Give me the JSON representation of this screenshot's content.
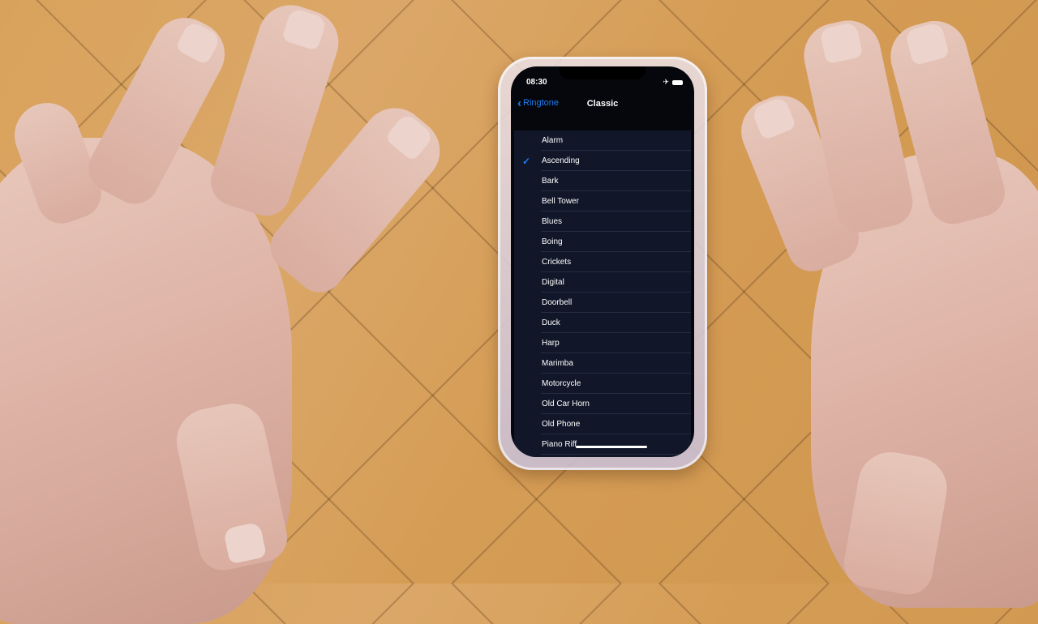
{
  "status_bar": {
    "time": "08:30",
    "icons": [
      "airplane-mode-icon",
      "battery-icon"
    ]
  },
  "nav": {
    "back_label": "Ringtone",
    "back_icon": "chevron-left-icon",
    "title": "Classic"
  },
  "ringtones": {
    "selected": "Ascending",
    "items": [
      {
        "label": "Alarm",
        "checked": false
      },
      {
        "label": "Ascending",
        "checked": true
      },
      {
        "label": "Bark",
        "checked": false
      },
      {
        "label": "Bell Tower",
        "checked": false
      },
      {
        "label": "Blues",
        "checked": false
      },
      {
        "label": "Boing",
        "checked": false
      },
      {
        "label": "Crickets",
        "checked": false
      },
      {
        "label": "Digital",
        "checked": false
      },
      {
        "label": "Doorbell",
        "checked": false
      },
      {
        "label": "Duck",
        "checked": false
      },
      {
        "label": "Harp",
        "checked": false
      },
      {
        "label": "Marimba",
        "checked": false
      },
      {
        "label": "Motorcycle",
        "checked": false
      },
      {
        "label": "Old Car Horn",
        "checked": false
      },
      {
        "label": "Old Phone",
        "checked": false
      },
      {
        "label": "Piano Riff",
        "checked": false
      }
    ]
  },
  "colors": {
    "accent": "#1e7cf2",
    "list_background": "#111729",
    "screen_background": "#05070d"
  }
}
